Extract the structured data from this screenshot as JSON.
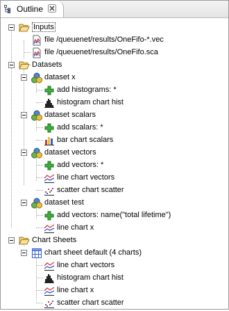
{
  "view": {
    "tab_title": "Outline",
    "tab_icon": "outline-icon",
    "close_icon": "close-icon"
  },
  "tree": {
    "inputs": {
      "label": "Inputs",
      "icon": "folder-open-icon",
      "files": [
        {
          "label": "file /queuenet/results/OneFifo-*.vec",
          "icon": "vector-file-icon"
        },
        {
          "label": "file /queuenet/results/OneFifo.sca",
          "icon": "scalar-file-icon"
        }
      ]
    },
    "datasets": {
      "label": "Datasets",
      "icon": "folder-open-icon",
      "items": [
        {
          "label": "dataset x",
          "children": [
            {
              "label": "add histograms: *",
              "icon": "add-icon"
            },
            {
              "label": "histogram chart hist",
              "icon": "histogram-chart-icon"
            }
          ]
        },
        {
          "label": "dataset scalars",
          "children": [
            {
              "label": "add scalars: *",
              "icon": "add-icon"
            },
            {
              "label": "bar chart scalars",
              "icon": "bar-chart-icon"
            }
          ]
        },
        {
          "label": "dataset vectors",
          "children": [
            {
              "label": "add vectors: *",
              "icon": "add-icon"
            },
            {
              "label": "line chart vectors",
              "icon": "line-chart-icon"
            },
            {
              "label": "scatter chart scatter",
              "icon": "scatter-chart-icon"
            }
          ]
        },
        {
          "label": "dataset test",
          "children": [
            {
              "label": "add vectors: name(\"total lifetime\")",
              "icon": "add-icon"
            },
            {
              "label": "line chart x",
              "icon": "line-chart-icon"
            }
          ]
        }
      ]
    },
    "chart_sheets": {
      "label": "Chart Sheets",
      "icon": "folder-open-icon",
      "items": [
        {
          "label": "chart sheet default (4 charts)",
          "icon": "chart-sheet-icon",
          "children": [
            {
              "label": "line chart vectors",
              "icon": "line-chart-icon"
            },
            {
              "label": "histogram chart hist",
              "icon": "histogram-chart-icon"
            },
            {
              "label": "line chart x",
              "icon": "line-chart-icon"
            },
            {
              "label": "scatter chart scatter",
              "icon": "scatter-chart-icon"
            }
          ]
        }
      ]
    }
  },
  "colors": {
    "folder": "#e8c35a",
    "add": "#2e9a2e",
    "dataset_blue": "#4f86c6",
    "dataset_green": "#6cb24a",
    "dataset_yellow": "#e9c23a",
    "line_red": "#d23a3a",
    "line_blue": "#3a5fd2"
  }
}
